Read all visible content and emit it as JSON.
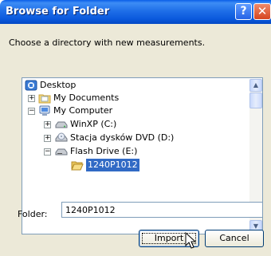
{
  "window": {
    "title": "Browse for Folder",
    "help_label": "?",
    "close_label": "✕"
  },
  "instruction": "Choose a directory with new measurements.",
  "tree": {
    "items": [
      {
        "label": "Desktop",
        "icon": "desktop-icon",
        "expander": "",
        "selected": false
      },
      {
        "label": "My Documents",
        "icon": "my-documents-icon",
        "expander": "+",
        "selected": false
      },
      {
        "label": "My Computer",
        "icon": "my-computer-icon",
        "expander": "−",
        "selected": false
      },
      {
        "label": "WinXP (C:)",
        "icon": "hard-drive-icon",
        "expander": "+",
        "selected": false
      },
      {
        "label": "Stacja dysków DVD (D:)",
        "icon": "dvd-drive-icon",
        "expander": "+",
        "selected": false
      },
      {
        "label": "Flash Drive (E:)",
        "icon": "removable-drive-icon",
        "expander": "−",
        "selected": false
      },
      {
        "label": "1240P1012",
        "icon": "folder-open-icon",
        "expander": "",
        "selected": true
      }
    ],
    "scrollbar": {
      "up_label": "▲",
      "down_label": "▼"
    }
  },
  "folder": {
    "label": "Folder:",
    "value": "1240P1012"
  },
  "buttons": {
    "import_label": "Import",
    "cancel_label": "Cancel"
  },
  "colors": {
    "titlebar": "#0a58dc",
    "selection": "#316ac5",
    "face": "#ece9d8"
  }
}
